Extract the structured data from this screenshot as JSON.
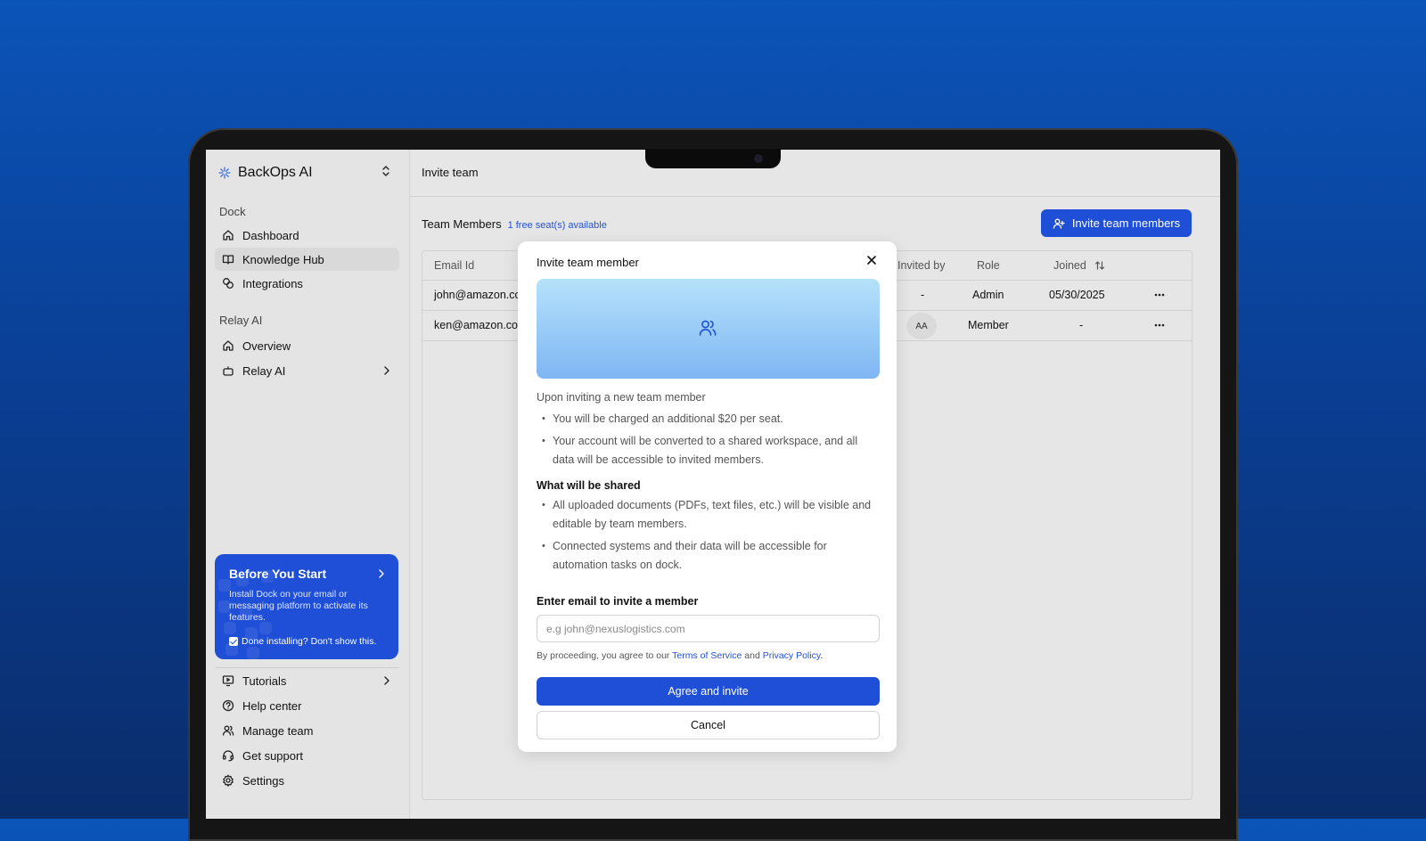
{
  "colors": {
    "accent": "#1f4fd6",
    "link": "#2451d8",
    "background_top": "#0b54b8",
    "background_bottom": "#0a2d6b"
  },
  "brand": {
    "name": "BackOps AI",
    "logo_icon": "sparkle-icon",
    "switch_icon": "chevron-up-down-icon"
  },
  "sidebar": {
    "sections": [
      {
        "label": "Dock",
        "items": [
          {
            "label": "Dashboard",
            "icon": "home-icon"
          },
          {
            "label": "Knowledge Hub",
            "icon": "book-icon",
            "active": true
          },
          {
            "label": "Integrations",
            "icon": "link-icon"
          }
        ]
      },
      {
        "label": "Relay AI",
        "items": [
          {
            "label": "Overview",
            "icon": "home-icon"
          },
          {
            "label": "Relay AI",
            "icon": "bot-icon",
            "has_chevron": true
          }
        ]
      }
    ],
    "promo": {
      "title": "Before You Start",
      "text": "Install Dock on your email or messaging platform to activate its features.",
      "checkbox_label": "Done installing? Don't show this."
    },
    "footer_items": [
      {
        "label": "Tutorials",
        "icon": "monitor-play-icon",
        "has_chevron": true
      },
      {
        "label": "Help center",
        "icon": "help-circle-icon"
      },
      {
        "label": "Manage team",
        "icon": "users-icon"
      },
      {
        "label": "Get support",
        "icon": "headset-icon"
      },
      {
        "label": "Settings",
        "icon": "gear-icon"
      }
    ]
  },
  "main": {
    "page_title": "Invite team",
    "team_members_title": "Team Members",
    "seats_available": "1 free seat(s) available",
    "invite_button_label": "Invite team members",
    "table": {
      "columns": [
        "Email Id",
        "Invited by",
        "Role",
        "Joined"
      ],
      "rows": [
        {
          "email": "john@amazon.com",
          "invited_by": "-",
          "role": "Admin",
          "joined": "05/30/2025"
        },
        {
          "email": "ken@amazon.com",
          "invited_by": "AA",
          "role": "Member",
          "joined": "-"
        }
      ]
    }
  },
  "modal": {
    "title": "Invite team member",
    "intro": "Upon inviting a new team member",
    "invite_bullets": [
      "You will be charged an additional $20 per seat.",
      "Your account will be converted to a shared workspace, and all data will be accessible to invited members."
    ],
    "shared_title": "What will be shared",
    "shared_bullets": [
      "All uploaded documents (PDFs, text files, etc.) will be visible and editable by team members.",
      "Connected systems and their data will be accessible for automation tasks on dock."
    ],
    "email_label": "Enter email to invite a member",
    "email_value": "",
    "email_placeholder": "e.g john@nexuslogistics.com",
    "terms_prefix": "By proceeding, you agree to our",
    "terms_link": "Terms of Service",
    "terms_and": "and",
    "privacy_link": "Privacy Policy",
    "terms_suffix": ".",
    "agree_label": "Agree and invite",
    "cancel_label": "Cancel"
  }
}
